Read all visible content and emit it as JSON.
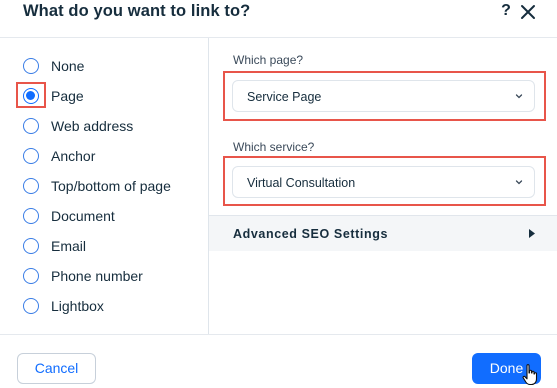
{
  "dialog": {
    "title": "What do you want to link to?",
    "help_glyph": "?",
    "close_icon": "close-icon"
  },
  "link_types": {
    "selected": "Page",
    "items": [
      {
        "label": "None",
        "checked": false
      },
      {
        "label": "Page",
        "checked": true
      },
      {
        "label": "Web address",
        "checked": false
      },
      {
        "label": "Anchor",
        "checked": false
      },
      {
        "label": "Top/bottom of page",
        "checked": false
      },
      {
        "label": "Document",
        "checked": false
      },
      {
        "label": "Email",
        "checked": false
      },
      {
        "label": "Phone number",
        "checked": false
      },
      {
        "label": "Lightbox",
        "checked": false
      }
    ]
  },
  "page_field": {
    "label": "Which page?",
    "value": "Service Page"
  },
  "service_field": {
    "label": "Which service?",
    "value": "Virtual Consultation"
  },
  "advanced": {
    "label": "Advanced SEO Settings"
  },
  "footer": {
    "cancel_label": "Cancel",
    "done_label": "Done"
  },
  "colors": {
    "accent": "#116dff",
    "highlight": "#e8554a",
    "text": "#162d3d"
  }
}
